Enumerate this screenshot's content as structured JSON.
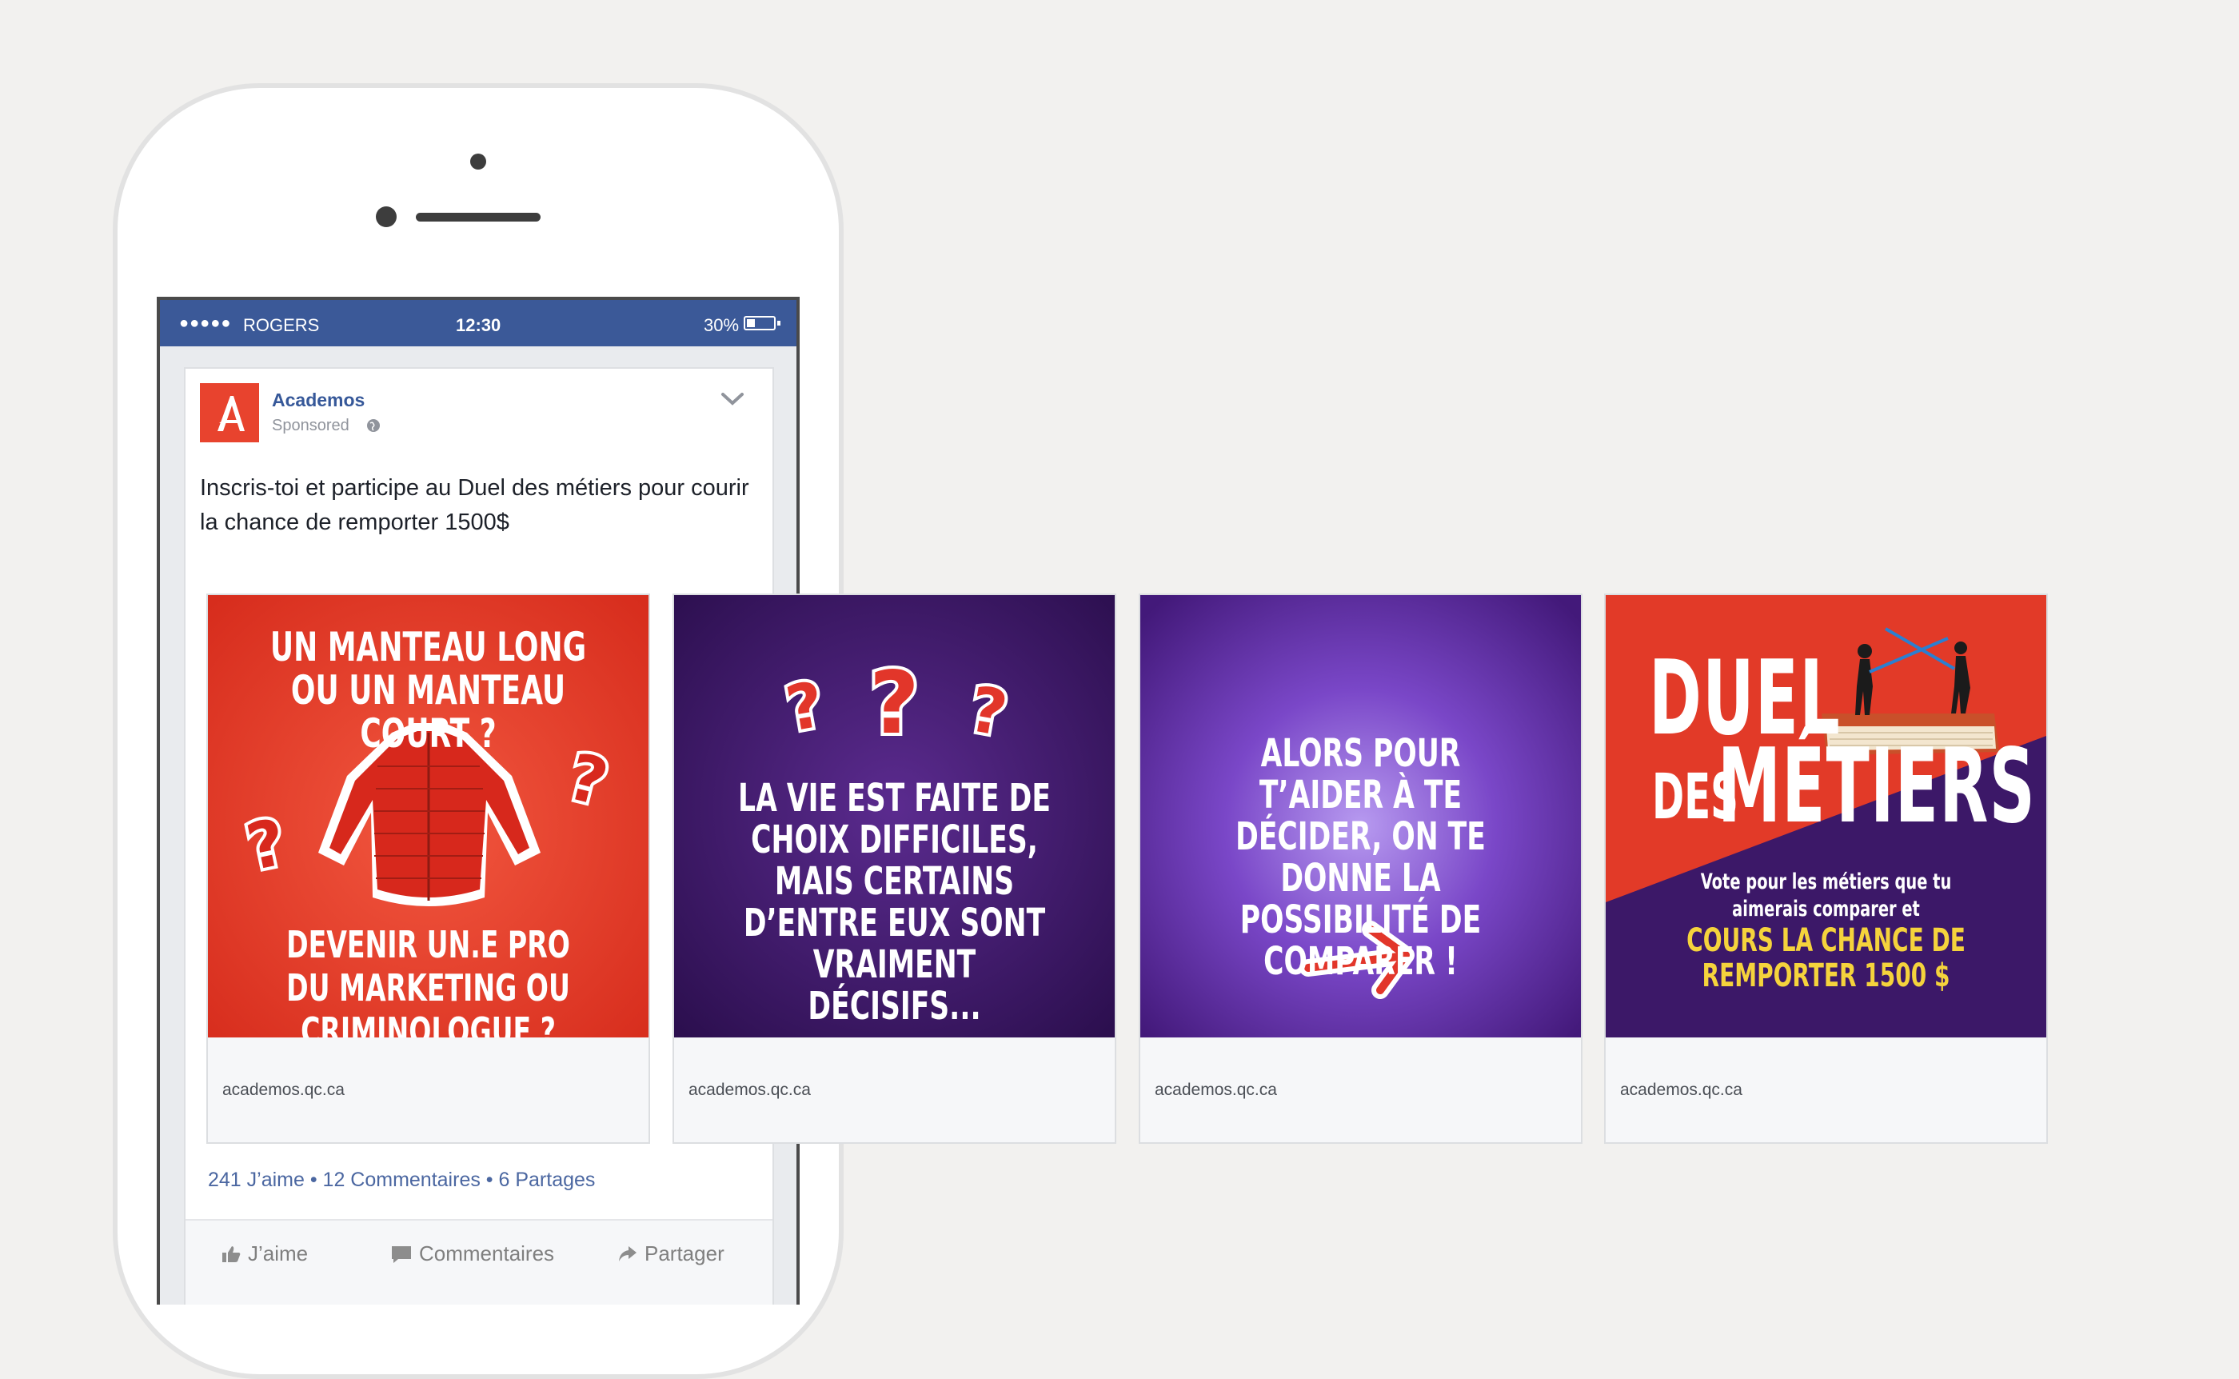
{
  "status_bar": {
    "signal": "●●●●●",
    "carrier": "ROGERS",
    "time": "12:30",
    "battery": "30%"
  },
  "post": {
    "page_name": "Academos",
    "sponsored_label": "Sponsored",
    "text": "Inscris-toi et participe au Duel des métiers pour courir la chance de remporter 1500$",
    "stats": "241 J’aime • 12 Commentaires • 6 Partages",
    "actions": {
      "like": "J’aime",
      "comment": "Commentaires",
      "share": "Partager"
    }
  },
  "cards": [
    {
      "line_top": "Un manteau long ou un manteau court ?",
      "line_bottom": "Devenir un.e pro du marketing ou criminologue ?",
      "url": "academos.qc.ca"
    },
    {
      "text": "La vie est faite de choix difficiles, mais certains d’entre eux sont vraiment décisifs...",
      "url": "academos.qc.ca"
    },
    {
      "text": "Alors pour t’aider à te décider, on te donne la possibilité de comparer !",
      "url": "academos.qc.ca"
    },
    {
      "title_duel": "DUEL",
      "title_des": "DES",
      "title_metiers": "MÉTIERS",
      "vote_text": "Vote pour les métiers que tu aimerais comparer et",
      "cours_text": "Cours la chance de remporter 1500 $",
      "url": "academos.qc.ca"
    }
  ],
  "colors": {
    "facebook_blue": "#3b5998",
    "academos_red": "#e8432e",
    "purple": "#4a2170"
  }
}
